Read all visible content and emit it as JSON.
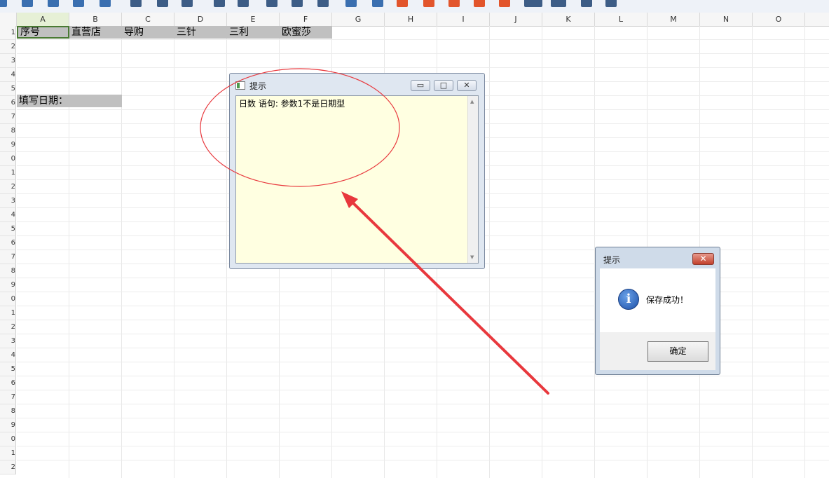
{
  "columns": [
    "A",
    "B",
    "C",
    "D",
    "E",
    "F",
    "G",
    "H",
    "I",
    "J",
    "K",
    "L",
    "M",
    "N",
    "O"
  ],
  "rows": [
    "1",
    "2",
    "3",
    "4",
    "5",
    "6",
    "7",
    "8",
    "9",
    "0",
    "1",
    "2",
    "3",
    "4",
    "5",
    "6",
    "7",
    "8",
    "9",
    "0",
    "1",
    "2",
    "3",
    "4",
    "5",
    "6",
    "7",
    "8",
    "9",
    "0",
    "1",
    "2"
  ],
  "cells": {
    "a1": "序号",
    "b1": "直营店",
    "c1": "导购",
    "d1": "三针",
    "e1": "三利",
    "f1": "欧蜜莎",
    "a6": "填写日期："
  },
  "hint_window": {
    "title": "提示",
    "message": "日数 语句: 参数1不是日期型",
    "minimize": "▭",
    "maximize": "□",
    "close": "✕"
  },
  "message_box": {
    "title": "提示",
    "close": "✕",
    "icon": "info-icon",
    "text": "保存成功！",
    "ok_label": "确定"
  },
  "colors": {
    "selected_column": "#e6f0d6",
    "header_cells": "#c0c0c0",
    "annotation": "#e8383d",
    "hint_body": "#ffffe1"
  }
}
